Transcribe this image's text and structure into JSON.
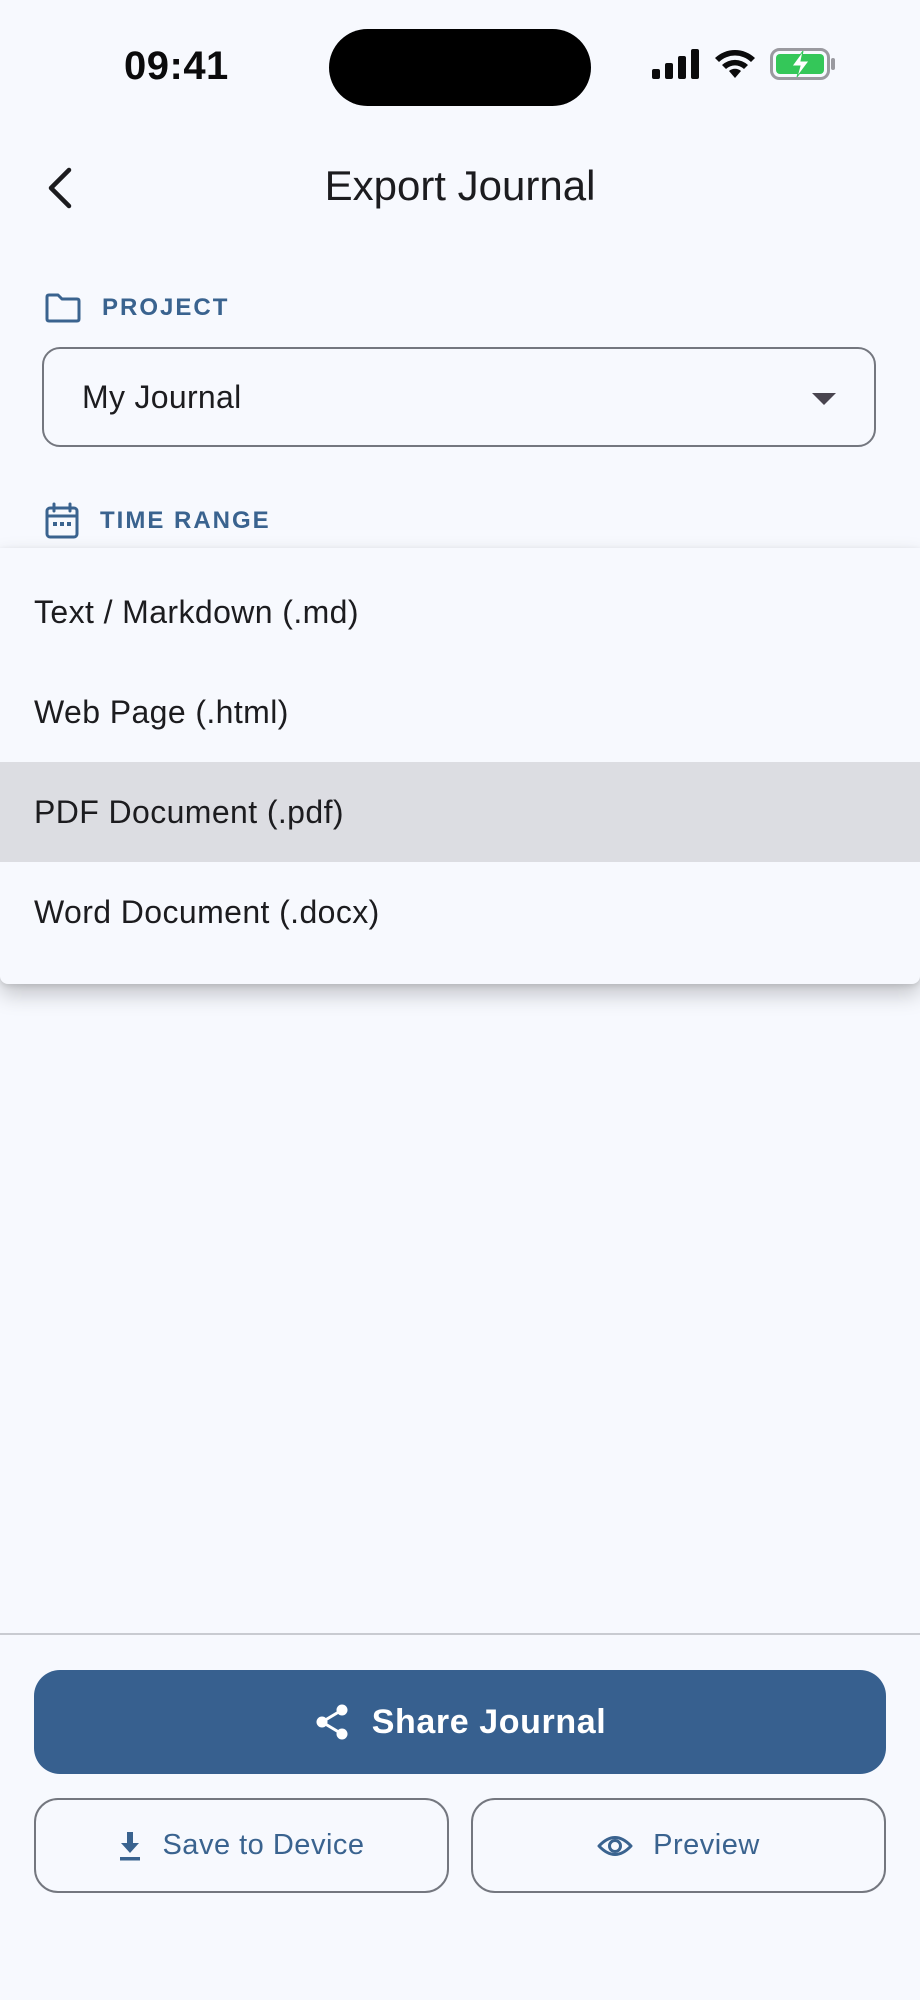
{
  "status_bar": {
    "time": "09:41",
    "icons": [
      "signal-icon",
      "wifi-icon",
      "battery-charging-icon"
    ]
  },
  "header": {
    "title": "Export Journal",
    "back_icon": "chevron-left-icon"
  },
  "project": {
    "label": "PROJECT",
    "icon": "folder-icon",
    "selected_value": "My Journal"
  },
  "time_range": {
    "label": "TIME RANGE",
    "icon": "calendar-icon"
  },
  "format_menu": {
    "items": [
      {
        "label": "Text / Markdown (.md)"
      },
      {
        "label": "Web Page (.html)"
      },
      {
        "label": "PDF Document (.pdf)"
      },
      {
        "label": "Word Document (.docx)"
      }
    ],
    "selected_index": 2
  },
  "actions": {
    "share_label": "Share Journal",
    "save_label": "Save to Device",
    "preview_label": "Preview"
  },
  "colors": {
    "accent": "#37608f",
    "label": "#3a638f",
    "background": "#f7f9fe",
    "menu_selected": "#dcdde2",
    "battery": "#34c759"
  }
}
